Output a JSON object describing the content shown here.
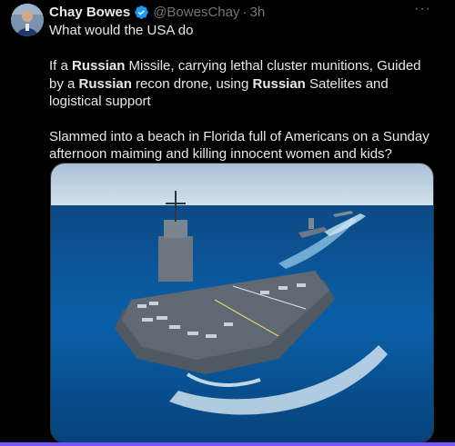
{
  "author": {
    "name": "Chay Bowes",
    "handle": "@BowesChay",
    "separator": "·",
    "time": "3h"
  },
  "tweet": {
    "line1": "What would the USA do",
    "p2_a": "If a ",
    "p2_b": "Russian",
    "p2_c": " Missile, carrying lethal cluster munitions, Guided by a ",
    "p2_d": "Russian",
    "p2_e": " recon drone, using ",
    "p2_f": "Russian",
    "p2_g": " Satelites and logistical support",
    "p3": "Slammed into a beach in Florida full of Americans on a Sunday afternoon maiming and killing innocent women and kids?"
  },
  "more_label": "···",
  "colors": {
    "background": "#000000",
    "text": "#e7e9ea",
    "muted": "#71767b",
    "verified": "#1d9bf0",
    "accent_bar": "#7856ff"
  },
  "icons": {
    "verified": "verified-badge-icon",
    "more": "more-options-icon"
  }
}
